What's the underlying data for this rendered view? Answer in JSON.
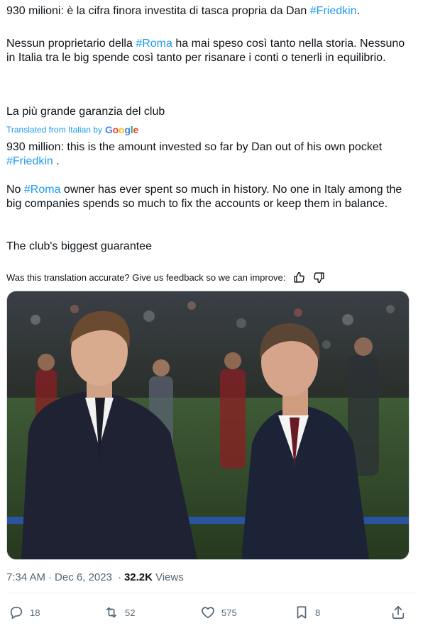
{
  "original": {
    "line1_pre": "930 milioni: è la cifra finora investita di tasca propria da Dan ",
    "line1_tag": "#Friedkin",
    "line1_post": ".",
    "para2_pre": "Nessun proprietario della ",
    "para2_tag": "#Roma",
    "para2_post": " ha mai speso così tanto nella storia. Nessuno in Italia tra le big spende così tanto per risanare i conti o tenerli in equilibrio.",
    "para3": "La più grande garanzia del club"
  },
  "translation": {
    "label": "Translated from Italian by",
    "provider": "Google",
    "provider_colors": [
      "#4285F4",
      "#EA4335",
      "#FBBC05",
      "#4285F4",
      "#34A853",
      "#EA4335"
    ],
    "line1_pre": "930 million: this is the amount invested so far by Dan out of his own pocket ",
    "line1_tag": "#Friedkin",
    "line1_post": " .",
    "para2_pre": "No ",
    "para2_tag": "#Roma",
    "para2_post": " owner has ever spent so much in history. No one in Italy among the big companies spends so much to fix the accounts or keep them in balance.",
    "para3": "The club's biggest guarantee"
  },
  "feedback": {
    "question": "Was this translation accurate? Give us feedback so we can improve:",
    "like_icon": "thumbs-up-icon",
    "dislike_icon": "thumbs-down-icon"
  },
  "media": {
    "description_icon": "photo"
  },
  "meta": {
    "time": "7:34 AM",
    "separator": "·",
    "date": "Dec 6, 2023",
    "views_count": "32.2K",
    "views_label": "Views"
  },
  "actions": {
    "replies": "18",
    "reposts": "52",
    "likes": "575",
    "bookmarks": "8"
  },
  "colors": {
    "accent": "#1d9bf0",
    "text": "#0f1419",
    "muted": "#536471"
  }
}
